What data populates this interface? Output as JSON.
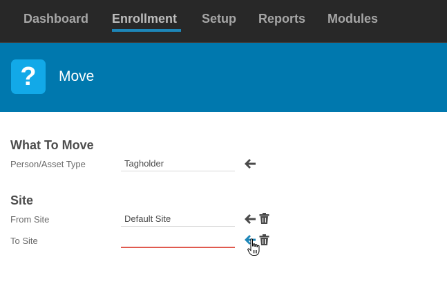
{
  "nav": {
    "items": [
      {
        "label": "Dashboard",
        "active": false
      },
      {
        "label": "Enrollment",
        "active": true
      },
      {
        "label": "Setup",
        "active": false
      },
      {
        "label": "Reports",
        "active": false
      },
      {
        "label": "Modules",
        "active": false
      }
    ]
  },
  "banner": {
    "icon_glyph": "?",
    "icon": "question-icon",
    "title": "Move"
  },
  "sections": {
    "what_to_move": {
      "title": "What To Move",
      "fields": [
        {
          "label": "Person/Asset Type",
          "value": "Tagholder"
        }
      ]
    },
    "site": {
      "title": "Site",
      "fields": [
        {
          "label": "From Site",
          "value": "Default Site"
        },
        {
          "label": "To Site",
          "value": ""
        }
      ]
    }
  },
  "colors": {
    "nav_bg": "#282828",
    "nav_active_underline": "#1d86b8",
    "banner_bg": "#0078ae",
    "banner_icon_bg": "#12a9e8",
    "error_underline": "#e05a4f",
    "icon_dark": "#4a4a4a",
    "icon_active": "#1d86b8"
  }
}
